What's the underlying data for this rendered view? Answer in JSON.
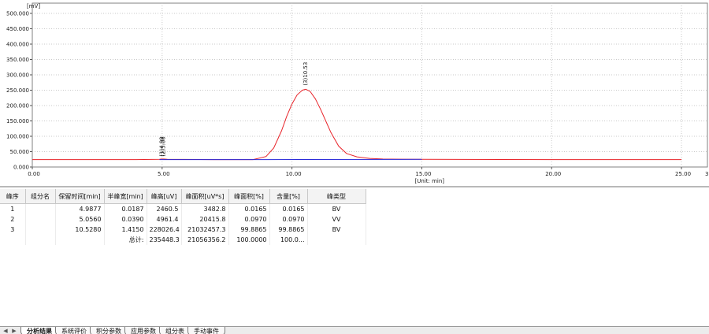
{
  "chart_data": {
    "type": "line",
    "y_unit": "[mV]",
    "x_unit": "[Unit: min]",
    "xlim": [
      0,
      26
    ],
    "ylim": [
      0,
      500
    ],
    "x_ticks": [
      "0.00",
      "5.00",
      "10.00",
      "15.00",
      "20.00",
      "25.00"
    ],
    "x_tick_values": [
      0,
      5,
      10,
      15,
      20,
      25
    ],
    "y_ticks": [
      "0.000",
      "50.000",
      "100.000",
      "150.000",
      "200.000",
      "250.000",
      "300.000",
      "350.000",
      "400.000",
      "450.000",
      "500.000"
    ],
    "y_tick_values": [
      0,
      50,
      100,
      150,
      200,
      250,
      300,
      350,
      400,
      450,
      500
    ],
    "grid": true,
    "series": [
      {
        "color": "#e8252b",
        "x": [
          0,
          2,
          4,
          4.9,
          4.98,
          5.06,
          5.2,
          7,
          8.5,
          9.0,
          9.3,
          9.6,
          9.8,
          10.0,
          10.2,
          10.4,
          10.53,
          10.7,
          10.9,
          11.1,
          11.3,
          11.5,
          11.8,
          12.1,
          12.5,
          13.0,
          13.5,
          15.0,
          20.0,
          25.0
        ],
        "y": [
          24,
          24,
          24,
          25,
          26,
          26,
          25,
          24,
          24,
          34,
          62,
          118,
          165,
          205,
          235,
          250,
          253,
          246,
          222,
          188,
          150,
          112,
          68,
          44,
          33,
          28,
          26,
          25,
          24,
          24
        ]
      },
      {
        "color": "#2b2bd9",
        "x": [
          4.9,
          5.1,
          9.0,
          15.0
        ],
        "y": [
          24,
          24,
          24,
          25
        ]
      }
    ],
    "peak_labels": [
      {
        "text": "(1)4.99",
        "x": 4.9877
      },
      {
        "text": "(2)5.06",
        "x": 5.056
      },
      {
        "text": "(3)10.53",
        "x": 10.528
      }
    ]
  },
  "table": {
    "headers": [
      "峰序",
      "组分名",
      "保留时间[min]",
      "半峰宽[min]",
      "峰高[uV]",
      "峰面积[uV*s]",
      "峰面积[%]",
      "含量[%]",
      "峰类型"
    ],
    "rows": [
      [
        "1",
        "",
        "4.9877",
        "0.0187",
        "2460.5",
        "3482.8",
        "0.0165",
        "0.0165",
        "BV"
      ],
      [
        "2",
        "",
        "5.0560",
        "0.0390",
        "4961.4",
        "20415.8",
        "0.0970",
        "0.0970",
        "VV"
      ],
      [
        "3",
        "",
        "10.5280",
        "1.4150",
        "228026.4",
        "21032457.3",
        "99.8865",
        "99.8865",
        "BV"
      ],
      [
        "",
        "",
        "",
        "总计:",
        "235448.3",
        "21056356.2",
        "100.0000",
        "100.0...",
        ""
      ]
    ]
  },
  "tabs": [
    {
      "label": "分析结果",
      "active": true
    },
    {
      "label": "系统评价",
      "active": false
    },
    {
      "label": "积分参数",
      "active": false
    },
    {
      "label": "应用参数",
      "active": false
    },
    {
      "label": "组分表",
      "active": false
    },
    {
      "label": "手动事件",
      "active": false
    }
  ]
}
